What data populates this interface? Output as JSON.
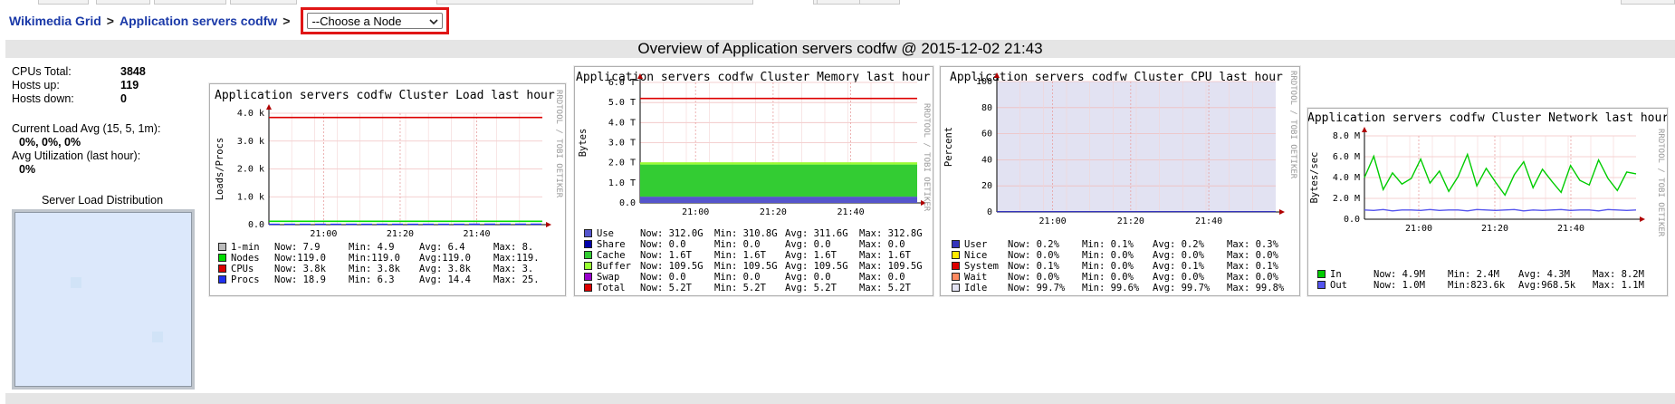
{
  "breadcrumb": {
    "grid": "Wikimedia Grid",
    "separator": ">",
    "cluster": "Application servers codfw",
    "node_select": "--Choose a Node"
  },
  "overview_title": "Overview of Application servers codfw @ 2015-12-02 21:43",
  "stats": {
    "cpus_label": "CPUs Total:",
    "cpus_value": "3848",
    "hosts_up_label": "Hosts up:",
    "hosts_up_value": "119",
    "hosts_down_label": "Hosts down:",
    "hosts_down_value": "0",
    "load_label": "Current Load Avg (15, 5, 1m):",
    "load_value": "0%, 0%, 0%",
    "util_label": "Avg Utilization (last hour):",
    "util_value": "0%",
    "sld_title": "Server Load Distribution"
  },
  "side_text": "RRDTOOL / TOBI OETIKER",
  "graphs": {
    "load": {
      "title": "Application servers codfw Cluster Load last hour",
      "ylabel": "Loads/Procs",
      "yticks": [
        "4.0 k",
        "3.0 k",
        "2.0 k",
        "1.0 k",
        "0.0"
      ],
      "xticks": [
        "21:00",
        "21:20",
        "21:40"
      ],
      "legend": [
        {
          "name": "1-min",
          "now": "Now:   7.9",
          "min": "Min:   4.9",
          "avg": "Avg:   6.4",
          "max": "Max:   8.",
          "color": "#bbbbbb"
        },
        {
          "name": "Nodes",
          "now": "Now:119.0",
          "min": "Min:119.0",
          "avg": "Avg:119.0",
          "max": "Max:119.",
          "color": "#00dd00"
        },
        {
          "name": "CPUs",
          "now": "Now:   3.8k",
          "min": "Min:   3.8k",
          "avg": "Avg:   3.8k",
          "max": "Max:   3.",
          "color": "#dd0000"
        },
        {
          "name": "Procs",
          "now": "Now:  18.9",
          "min": "Min:   6.3",
          "avg": "Avg:  14.4",
          "max": "Max:  25.",
          "color": "#2030f0"
        }
      ]
    },
    "memory": {
      "title": "Application servers codfw Cluster Memory last hour",
      "ylabel": "Bytes",
      "yticks": [
        "6.0 T",
        "5.0 T",
        "4.0 T",
        "3.0 T",
        "2.0 T",
        "1.0 T",
        "0.0"
      ],
      "xticks": [
        "21:00",
        "21:20",
        "21:40"
      ],
      "legend": [
        {
          "name": "Use",
          "now": "Now: 312.0G",
          "min": "Min: 310.8G",
          "avg": "Avg: 311.6G",
          "max": "Max: 312.8G",
          "color": "#5555cc"
        },
        {
          "name": "Share",
          "now": "Now:    0.0",
          "min": "Min:    0.0",
          "avg": "Avg:    0.0",
          "max": "Max:    0.0",
          "color": "#0000aa"
        },
        {
          "name": "Cache",
          "now": "Now:   1.6T",
          "min": "Min:   1.6T",
          "avg": "Avg:   1.6T",
          "max": "Max:   1.6T",
          "color": "#33cc33"
        },
        {
          "name": "Buffer",
          "now": "Now: 109.5G",
          "min": "Min: 109.5G",
          "avg": "Avg: 109.5G",
          "max": "Max: 109.5G",
          "color": "#99ff33"
        },
        {
          "name": "Swap",
          "now": "Now:    0.0",
          "min": "Min:    0.0",
          "avg": "Avg:    0.0",
          "max": "Max:    0.0",
          "color": "#9900cc"
        },
        {
          "name": "Total",
          "now": "Now:   5.2T",
          "min": "Min:   5.2T",
          "avg": "Avg:   5.2T",
          "max": "Max:   5.2T",
          "color": "#dd0000"
        }
      ]
    },
    "cpu": {
      "title": "Application servers codfw Cluster CPU last hour",
      "ylabel": "Percent",
      "yticks": [
        "100",
        "80",
        "60",
        "40",
        "20",
        "0"
      ],
      "xticks": [
        "21:00",
        "21:20",
        "21:40"
      ],
      "legend": [
        {
          "name": "User",
          "now": "Now:  0.2%",
          "min": "Min:  0.1%",
          "avg": "Avg:  0.2%",
          "max": "Max:  0.3%",
          "color": "#3333bb"
        },
        {
          "name": "Nice",
          "now": "Now:  0.0%",
          "min": "Min:  0.0%",
          "avg": "Avg:  0.0%",
          "max": "Max:  0.0%",
          "color": "#ffea00"
        },
        {
          "name": "System",
          "now": "Now:  0.1%",
          "min": "Min:  0.0%",
          "avg": "Avg:  0.1%",
          "max": "Max:  0.1%",
          "color": "#dd0000"
        },
        {
          "name": "Wait",
          "now": "Now:  0.0%",
          "min": "Min:  0.0%",
          "avg": "Avg:  0.0%",
          "max": "Max:  0.0%",
          "color": "#ff8a60"
        },
        {
          "name": "Idle",
          "now": "Now: 99.7%",
          "min": "Min: 99.6%",
          "avg": "Avg: 99.7%",
          "max": "Max: 99.8%",
          "color": "#e2e2f2"
        }
      ]
    },
    "network": {
      "title": "Application servers codfw Cluster Network last hour",
      "ylabel": "Bytes/sec",
      "yticks": [
        "8.0 M",
        "6.0 M",
        "4.0 M",
        "2.0 M",
        "0.0"
      ],
      "xticks": [
        "21:00",
        "21:20",
        "21:40"
      ],
      "legend": [
        {
          "name": "In",
          "now": "Now:  4.9M",
          "min": "Min:  2.4M",
          "avg": "Avg:  4.3M",
          "max": "Max:  8.2M",
          "color": "#00cc00"
        },
        {
          "name": "Out",
          "now": "Now:  1.0M",
          "min": "Min:823.6k",
          "avg": "Avg:968.5k",
          "max": "Max:  1.1M",
          "color": "#5555ee"
        }
      ]
    }
  },
  "chart_data": [
    {
      "type": "line",
      "title": "Application servers codfw Cluster Load last hour",
      "ylabel": "Loads/Procs",
      "ylim": [
        0,
        4000
      ],
      "x": [
        "21:00",
        "21:20",
        "21:40"
      ],
      "series": [
        {
          "name": "1-min",
          "values": [
            6.4,
            6.4,
            7.9
          ]
        },
        {
          "name": "Nodes",
          "values": [
            119,
            119,
            119
          ]
        },
        {
          "name": "CPUs",
          "values": [
            3848,
            3848,
            3848
          ]
        },
        {
          "name": "Procs",
          "values": [
            14.4,
            14.4,
            18.9
          ]
        }
      ]
    },
    {
      "type": "area",
      "title": "Application servers codfw Cluster Memory last hour",
      "ylabel": "Bytes",
      "ylim": [
        0,
        6
      ],
      "x": [
        "21:00",
        "21:20",
        "21:40"
      ],
      "series": [
        {
          "name": "Use",
          "values": [
            0.312,
            0.312,
            0.312
          ]
        },
        {
          "name": "Cache",
          "values": [
            1.6,
            1.6,
            1.6
          ]
        },
        {
          "name": "Buffer",
          "values": [
            0.1095,
            0.1095,
            0.1095
          ]
        },
        {
          "name": "Total",
          "values": [
            5.2,
            5.2,
            5.2
          ]
        }
      ]
    },
    {
      "type": "area",
      "title": "Application servers codfw Cluster CPU last hour",
      "ylabel": "Percent",
      "ylim": [
        0,
        100
      ],
      "x": [
        "21:00",
        "21:20",
        "21:40"
      ],
      "series": [
        {
          "name": "User",
          "values": [
            0.2,
            0.2,
            0.2
          ]
        },
        {
          "name": "System",
          "values": [
            0.1,
            0.1,
            0.1
          ]
        },
        {
          "name": "Idle",
          "values": [
            99.7,
            99.7,
            99.7
          ]
        }
      ]
    },
    {
      "type": "line",
      "title": "Application servers codfw Cluster Network last hour",
      "ylabel": "Bytes/sec",
      "ylim": [
        0,
        9
      ],
      "x": [
        "21:00",
        "21:20",
        "21:40"
      ],
      "series": [
        {
          "name": "In",
          "values": [
            4.5,
            6.8,
            3.2,
            5.0,
            3.8,
            4.4,
            6.5,
            3.9,
            5.2,
            3.0,
            4.6,
            7.0,
            3.6,
            5.5,
            4.0,
            2.6,
            4.8,
            6.2,
            3.4,
            5.4,
            4.1,
            2.9,
            5.8,
            4.2,
            3.7,
            6.4,
            4.4,
            3.1,
            5.1,
            4.9
          ]
        },
        {
          "name": "Out",
          "values": [
            1.0,
            0.95,
            1.05,
            0.9,
            1.0,
            1.0,
            0.95,
            1.05,
            0.95,
            1.0,
            1.0,
            0.9,
            1.05,
            1.0,
            0.95,
            1.0,
            1.05,
            0.9,
            1.0,
            0.95,
            1.0,
            1.05,
            0.95,
            1.0,
            1.0,
            0.9,
            1.05,
            1.0,
            0.95,
            1.0
          ]
        }
      ]
    }
  ]
}
